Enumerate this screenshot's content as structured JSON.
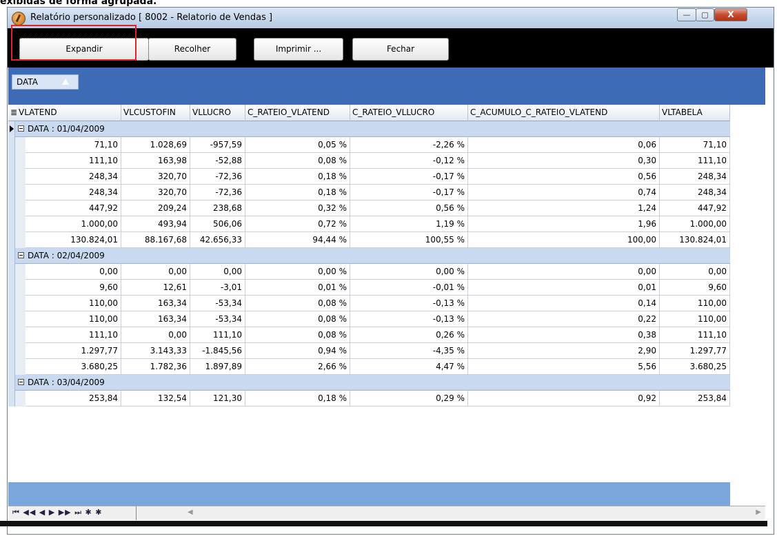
{
  "caption": "exibidas de forma agrupada.",
  "window": {
    "title": "Relatório personalizado   [ 8002 - Relatorio de Vendas ]",
    "min_label": "—",
    "max_label": "▢",
    "close_label": "X"
  },
  "toolbar": {
    "expandir": "Expandir",
    "recolher": "Recolher",
    "imprimir": "Imprimir ...",
    "fechar": "Fechar"
  },
  "group_panel": {
    "chip_label": "DATA"
  },
  "columns": [
    "VLATEND",
    "VLCUSTOFIN",
    "VLLUCRO",
    "C_RATEIO_VLATEND",
    "C_RATEIO_VLLUCRO",
    "C_ACUMULO_C_RATEIO_VLATEND",
    "VLTABELA"
  ],
  "groups": [
    {
      "label": "DATA : 01/04/2009",
      "rows": [
        [
          "71,10",
          "1.028,69",
          "-957,59",
          "0,05 %",
          "-2,26 %",
          "0,06",
          "71,10"
        ],
        [
          "111,10",
          "163,98",
          "-52,88",
          "0,08 %",
          "-0,12 %",
          "0,30",
          "111,10"
        ],
        [
          "248,34",
          "320,70",
          "-72,36",
          "0,18 %",
          "-0,17 %",
          "0,56",
          "248,34"
        ],
        [
          "248,34",
          "320,70",
          "-72,36",
          "0,18 %",
          "-0,17 %",
          "0,74",
          "248,34"
        ],
        [
          "447,92",
          "209,24",
          "238,68",
          "0,32 %",
          "0,56 %",
          "1,24",
          "447,92"
        ],
        [
          "1.000,00",
          "493,94",
          "506,06",
          "0,72 %",
          "1,19 %",
          "1,96",
          "1.000,00"
        ],
        [
          "130.824,01",
          "88.167,68",
          "42.656,33",
          "94,44 %",
          "100,55 %",
          "100,00",
          "130.824,01"
        ]
      ]
    },
    {
      "label": "DATA : 02/04/2009",
      "rows": [
        [
          "0,00",
          "0,00",
          "0,00",
          "0,00 %",
          "0,00 %",
          "0,00",
          "0,00"
        ],
        [
          "9,60",
          "12,61",
          "-3,01",
          "0,01 %",
          "-0,01 %",
          "0,01",
          "9,60"
        ],
        [
          "110,00",
          "163,34",
          "-53,34",
          "0,08 %",
          "-0,13 %",
          "0,14",
          "110,00"
        ],
        [
          "110,00",
          "163,34",
          "-53,34",
          "0,08 %",
          "-0,13 %",
          "0,22",
          "110,00"
        ],
        [
          "111,10",
          "0,00",
          "111,10",
          "0,08 %",
          "0,26 %",
          "0,38",
          "111,10"
        ],
        [
          "1.297,77",
          "3.143,33",
          "-1.845,56",
          "0,94 %",
          "-4,35 %",
          "2,90",
          "1.297,77"
        ],
        [
          "3.680,25",
          "1.782,36",
          "1.897,89",
          "2,66 %",
          "4,47 %",
          "5,56",
          "3.680,25"
        ]
      ]
    },
    {
      "label": "DATA : 03/04/2009",
      "rows": [
        [
          "253,84",
          "132,54",
          "121,30",
          "0,18 %",
          "0,29 %",
          "0,92",
          "253,84"
        ]
      ]
    }
  ],
  "navigator": {
    "buttons": "⏮ ◀◀ ◀ ▶ ▶▶ ⏭ ✱ ✱"
  },
  "colors": {
    "group_panel": "#3d6bb6",
    "group_row": "#c9daf0",
    "highlight": "#e0222a"
  }
}
